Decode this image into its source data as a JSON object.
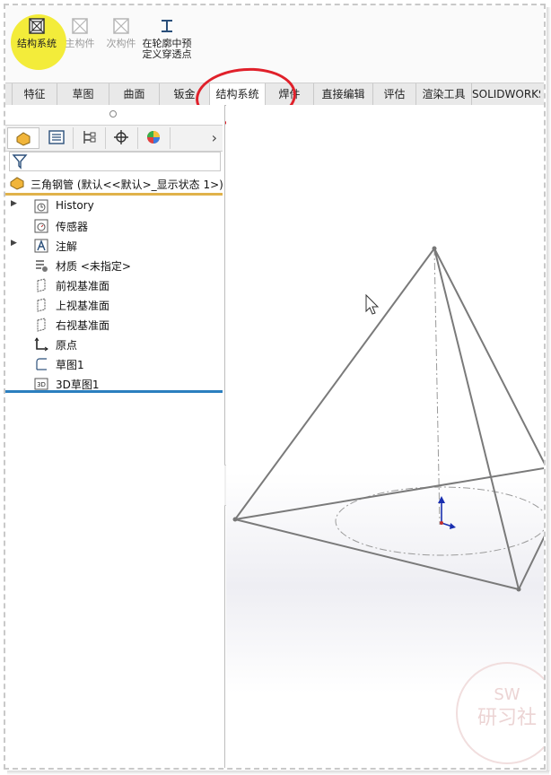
{
  "toolbar": {
    "items": [
      {
        "label": "结构系统",
        "icon": "structure-system-icon",
        "state": "enabled"
      },
      {
        "label": "主构件",
        "icon": "primary-member-icon",
        "state": "disabled"
      },
      {
        "label": "次构件",
        "icon": "secondary-member-icon",
        "state": "disabled"
      },
      {
        "label": "在轮廓中预定义穿透点",
        "icon": "beam-profile-icon",
        "state": "enabled"
      }
    ]
  },
  "tabs": [
    "特征",
    "草图",
    "曲面",
    "钣金",
    "结构系统",
    "焊件",
    "直接编辑",
    "评估",
    "渲染工具",
    "SOLIDWORKS"
  ],
  "active_tab": "结构系统",
  "tree": {
    "root": "三角钢管 (默认<<默认>_显示状态 1>)",
    "items": [
      {
        "label": "History",
        "icon": "history-icon",
        "expandable": true
      },
      {
        "label": "传感器",
        "icon": "sensor-icon",
        "expandable": false
      },
      {
        "label": "注解",
        "icon": "annotation-icon",
        "expandable": true
      },
      {
        "label": "材质 <未指定>",
        "icon": "material-icon",
        "expandable": false
      },
      {
        "label": "前视基准面",
        "icon": "plane-icon",
        "expandable": false
      },
      {
        "label": "上视基准面",
        "icon": "plane-icon",
        "expandable": false
      },
      {
        "label": "右视基准面",
        "icon": "plane-icon",
        "expandable": false
      },
      {
        "label": "原点",
        "icon": "origin-icon",
        "expandable": false
      },
      {
        "label": "草图1",
        "icon": "sketch-icon",
        "expandable": false
      },
      {
        "label": "3D草图1",
        "icon": "3d-sketch-icon",
        "expandable": false
      }
    ]
  },
  "watermark": {
    "line1": "SW",
    "line2": "研习社"
  },
  "colors": {
    "highlight": "#f3ec3a",
    "annotation": "#e0202a",
    "root_line": "#e0b24a",
    "end_line": "#2b7fbf"
  }
}
